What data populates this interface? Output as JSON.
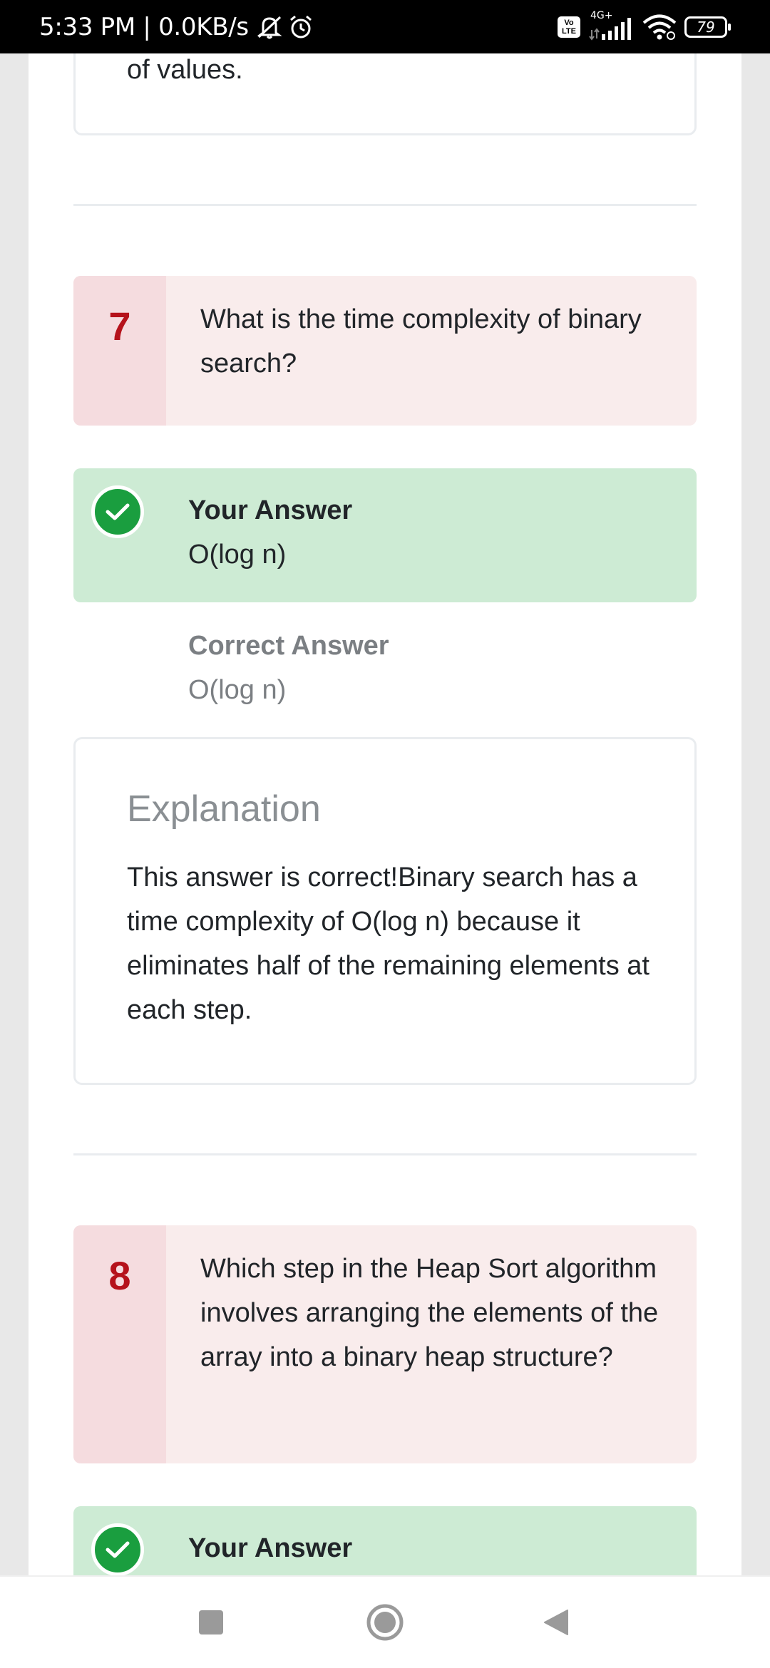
{
  "status_bar": {
    "time_speed": "5:33 PM | 0.0KB/s",
    "network_type": "4G+",
    "volte_top": "Vo",
    "volte_bottom": "LTE",
    "battery": "79"
  },
  "previous_explanation_tail": "of values.",
  "questions": [
    {
      "number": "7",
      "text": "What is the time complexity of binary search?",
      "your_answer_label": "Your Answer",
      "your_answer": "O(log n)",
      "correct_answer_label": "Correct Answer",
      "correct_answer": "O(log n)",
      "explanation_heading": "Explanation",
      "explanation": "This answer is correct!Binary search has a time complexity of O(log n) because it eliminates half of the remaining elements at each step."
    },
    {
      "number": "8",
      "text": "Which step in the Heap Sort algorithm involves arranging the elements of the array into a binary heap structure?",
      "your_answer_label": "Your Answer"
    }
  ],
  "icons": {
    "answer_status": "check-circle-icon",
    "nav_recents": "square-icon",
    "nav_home": "circle-icon",
    "nav_back": "triangle-back-icon"
  },
  "colors": {
    "question_bg": "#f9ecec",
    "question_number": "#b5121b",
    "answer_correct_bg": "#cdebd4",
    "check_green": "#1a9e3f"
  }
}
